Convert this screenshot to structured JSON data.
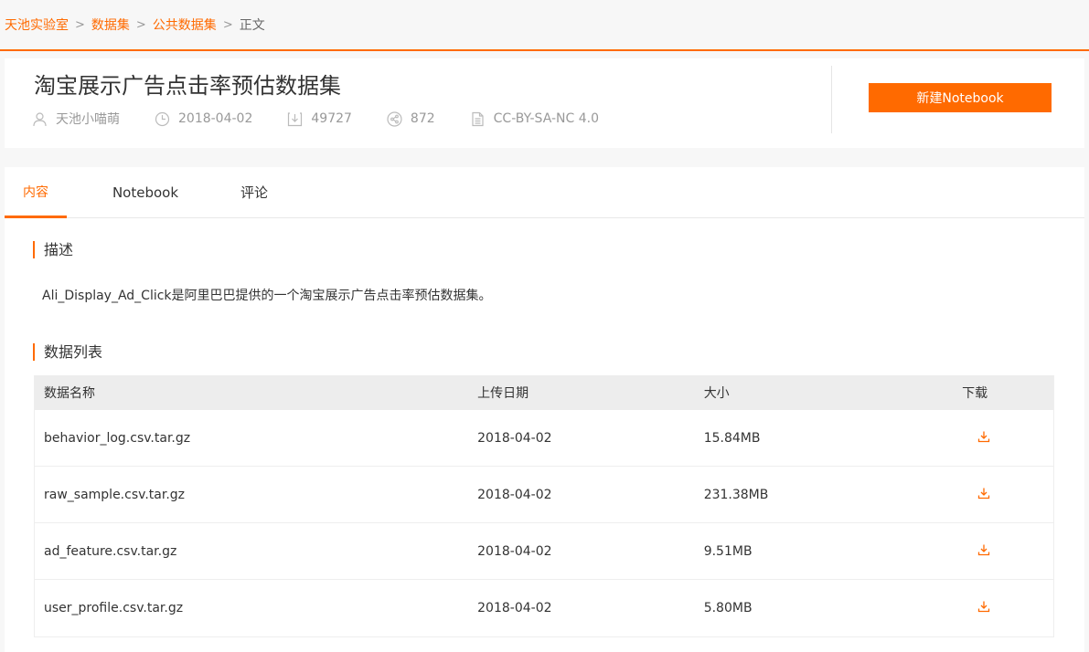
{
  "breadcrumb": [
    {
      "label": "天池实验室",
      "link": true
    },
    {
      "label": "数据集",
      "link": true
    },
    {
      "label": "公共数据集",
      "link": true
    },
    {
      "label": "正文",
      "link": false
    }
  ],
  "header": {
    "title": "淘宝展示广告点击率预估数据集",
    "author": "天池小喵萌",
    "date": "2018-04-02",
    "downloads": "49727",
    "shares": "872",
    "license": "CC-BY-SA-NC 4.0",
    "new_notebook_label": "新建Notebook"
  },
  "tabs": [
    {
      "label": "内容",
      "active": true
    },
    {
      "label": "Notebook",
      "active": false
    },
    {
      "label": "评论",
      "active": false
    }
  ],
  "description_section": {
    "heading": "描述",
    "text": "Ali_Display_Ad_Click是阿里巴巴提供的一个淘宝展示广告点击率预估数据集。"
  },
  "data_list": {
    "heading": "数据列表",
    "columns": {
      "name": "数据名称",
      "date": "上传日期",
      "size": "大小",
      "download": "下载"
    },
    "rows": [
      {
        "name": "behavior_log.csv.tar.gz",
        "date": "2018-04-02",
        "size": "15.84MB"
      },
      {
        "name": "raw_sample.csv.tar.gz",
        "date": "2018-04-02",
        "size": "231.38MB"
      },
      {
        "name": "ad_feature.csv.tar.gz",
        "date": "2018-04-02",
        "size": "9.51MB"
      },
      {
        "name": "user_profile.csv.tar.gz",
        "date": "2018-04-02",
        "size": "5.80MB"
      }
    ]
  },
  "icons": {
    "author": "user-icon",
    "date": "clock-icon",
    "downloads": "download-icon",
    "shares": "share-icon",
    "license": "document-icon",
    "row_download": "download-icon"
  },
  "colors": {
    "accent": "#ff6a00",
    "muted": "#999999"
  }
}
